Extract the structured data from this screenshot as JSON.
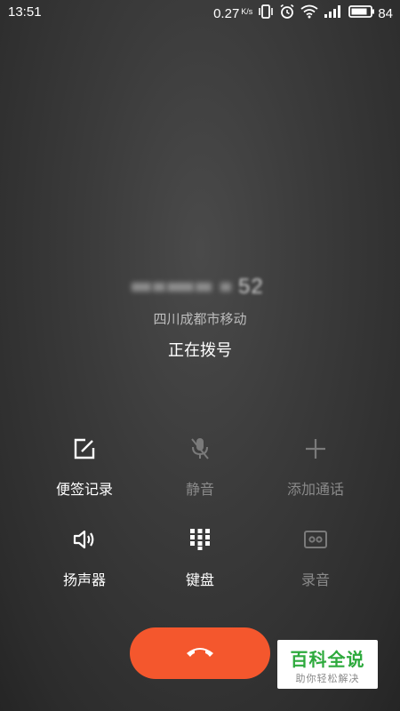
{
  "status_bar": {
    "time": "13:51",
    "net_speed": "0.27",
    "net_speed_unit": "K/s",
    "battery": "84",
    "icons": [
      "vibrate-icon",
      "alarm-icon",
      "wifi-icon",
      "signal-icon",
      "battery-icon"
    ]
  },
  "call": {
    "number_visible_tail": "52",
    "location": "四川成都市移动",
    "status": "正在拨号"
  },
  "actions": [
    {
      "label": "便签记录",
      "icon": "note-edit-icon",
      "enabled": true
    },
    {
      "label": "静音",
      "icon": "mic-off-icon",
      "enabled": false
    },
    {
      "label": "添加通话",
      "icon": "plus-icon",
      "enabled": false
    },
    {
      "label": "扬声器",
      "icon": "speaker-icon",
      "enabled": true
    },
    {
      "label": "键盘",
      "icon": "keypad-icon",
      "enabled": true
    },
    {
      "label": "录音",
      "icon": "record-icon",
      "enabled": false
    }
  ],
  "end_call": {
    "icon": "hang-up-icon",
    "color": "#f4572d"
  },
  "watermark": {
    "title": "百科全说",
    "subtitle": "助你轻松解决",
    "color": "#2eaa3d"
  }
}
